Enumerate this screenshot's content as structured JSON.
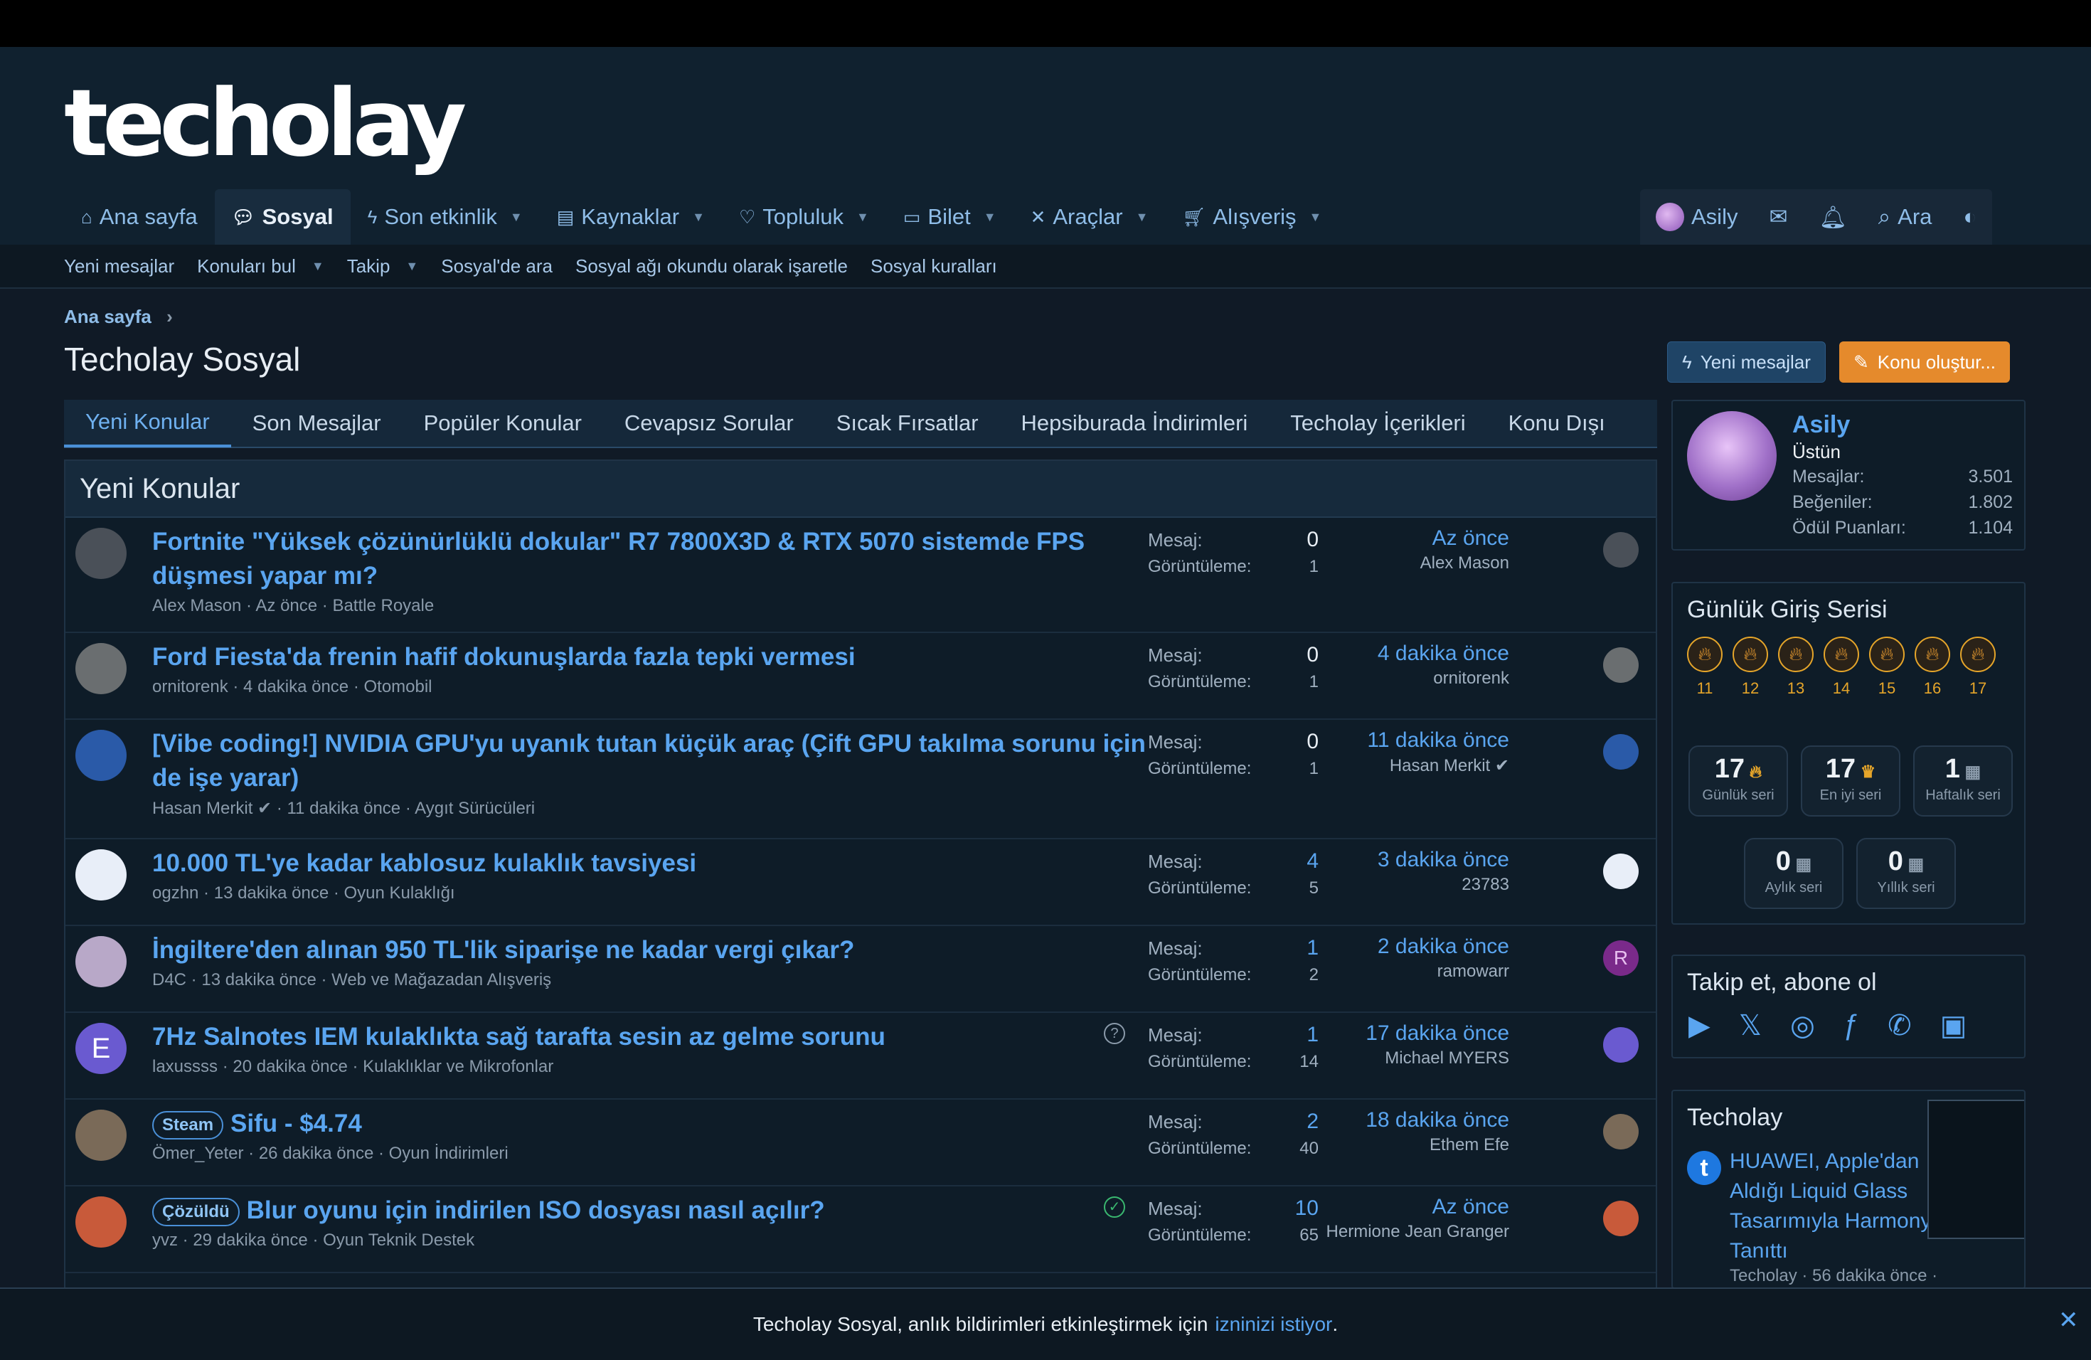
{
  "header": {
    "logo": "techolay"
  },
  "nav": {
    "items": [
      {
        "label": "Ana sayfa",
        "icon": "home-icon",
        "active": false,
        "caret": false
      },
      {
        "label": "Sosyal",
        "icon": "chat-icon",
        "active": true,
        "caret": false
      },
      {
        "label": "Son etkinlik",
        "icon": "bolt-icon",
        "active": false,
        "caret": true
      },
      {
        "label": "Kaynaklar",
        "icon": "archive-icon",
        "active": false,
        "caret": true
      },
      {
        "label": "Topluluk",
        "icon": "heart-icon",
        "active": false,
        "caret": true
      },
      {
        "label": "Bilet",
        "icon": "ticket-icon",
        "active": false,
        "caret": true
      },
      {
        "label": "Araçlar",
        "icon": "tools-icon",
        "active": false,
        "caret": true
      },
      {
        "label": "Alışveriş",
        "icon": "cart-icon",
        "active": false,
        "caret": true
      }
    ],
    "user": "Asily",
    "search": "Ara"
  },
  "subnav": {
    "items": [
      "Yeni mesajlar",
      "Konuları bul",
      "Takip",
      "Sosyal'de ara",
      "Sosyal ağı okundu olarak işaretle",
      "Sosyal kuralları"
    ]
  },
  "breadcrumb": "Ana sayfa",
  "page_title": "Techolay Sosyal",
  "buttons": {
    "new_messages": "Yeni mesajlar",
    "create": "Konu oluştur..."
  },
  "tabs": [
    "Yeni Konular",
    "Son Mesajlar",
    "Popüler Konular",
    "Cevapsız Sorular",
    "Sıcak Fırsatlar",
    "Hepsiburada İndirimleri",
    "Techolay İçerikleri",
    "Konu Dışı"
  ],
  "list": {
    "title": "Yeni Konular",
    "stat_labels": {
      "messages": "Mesaj:",
      "views": "Görüntüleme:"
    },
    "rows": [
      {
        "title": "Fortnite \"Yüksek çözünürlüklü dokular\" R7 7800X3D & RTX 5070 sistemde FPS düşmesi yapar mı?",
        "meta": "Alex Mason · Az önce · Battle Royale",
        "messages": "0",
        "views": "1",
        "last_time": "Az önce",
        "last_user": "Alex Mason",
        "prefix": ""
      },
      {
        "title": "Ford Fiesta'da frenin hafif dokunuşlarda fazla tepki vermesi",
        "meta": "ornitorenk · 4 dakika önce · Otomobil",
        "messages": "0",
        "views": "1",
        "last_time": "4 dakika önce",
        "last_user": "ornitorenk",
        "prefix": ""
      },
      {
        "title": "[Vibe coding!] NVIDIA GPU'yu uyanık tutan küçük araç (Çift GPU takılma sorunu için de işe yarar)",
        "meta": "Hasan Merkit ✔ · 11 dakika önce · Aygıt Sürücüleri",
        "messages": "0",
        "views": "1",
        "last_time": "11 dakika önce",
        "last_user": "Hasan Merkit ✔",
        "prefix": ""
      },
      {
        "title": "10.000 TL'ye kadar kablosuz kulaklık tavsiyesi",
        "meta": "ogzhn · 13 dakika önce · Oyun Kulaklığı",
        "messages": "4",
        "views": "5",
        "last_time": "3 dakika önce",
        "last_user": "23783",
        "prefix": ""
      },
      {
        "title": "İngiltere'den alınan 950 TL'lik siparişe ne kadar vergi çıkar?",
        "meta": "D4C · 13 dakika önce · Web ve Mağazadan Alışveriş",
        "messages": "1",
        "views": "2",
        "last_time": "2 dakika önce",
        "last_user": "ramowarr",
        "prefix": ""
      },
      {
        "title": "7Hz Salnotes IEM kulaklıkta sağ tarafta sesin az gelme sorunu",
        "meta": "laxussss · 20 dakika önce · Kulaklıklar ve Mikrofonlar",
        "messages": "1",
        "views": "14",
        "last_time": "17 dakika önce",
        "last_user": "Michael MYERS",
        "prefix": ""
      },
      {
        "title": "Sifu - $4.74",
        "meta": "Ömer_Yeter · 26 dakika önce · Oyun İndirimleri",
        "messages": "2",
        "views": "40",
        "last_time": "18 dakika önce",
        "last_user": "Ethem Efe",
        "prefix": "Steam"
      },
      {
        "title": "Blur oyunu için indirilen ISO dosyası nasıl açılır?",
        "meta": "yvz · 29 dakika önce · Oyun Teknik Destek",
        "messages": "10",
        "views": "65",
        "last_time": "Az önce",
        "last_user": "Hermione Jean Granger",
        "prefix": "Çözüldü"
      }
    ]
  },
  "profile": {
    "name": "Asily",
    "rank": "Üstün",
    "stats": [
      {
        "label": "Mesajlar:",
        "value": "3.501"
      },
      {
        "label": "Beğeniler:",
        "value": "1.802"
      },
      {
        "label": "Ödül Puanları:",
        "value": "1.104"
      }
    ]
  },
  "streak": {
    "title": "Günlük Giriş Serisi",
    "days": [
      "11",
      "12",
      "13",
      "14",
      "15",
      "16",
      "17"
    ],
    "boxes": [
      {
        "value": "17",
        "label": "Günlük seri"
      },
      {
        "value": "17",
        "label": "En iyi seri"
      },
      {
        "value": "1",
        "label": "Haftalık seri"
      },
      {
        "value": "0",
        "label": "Aylık seri"
      },
      {
        "value": "0",
        "label": "Yıllık seri"
      }
    ]
  },
  "follow": {
    "title": "Takip et, abone ol",
    "icons": [
      "youtube-icon",
      "x-icon",
      "instagram-icon",
      "facebook-icon",
      "whatsapp-icon",
      "linkedin-icon"
    ]
  },
  "techolay_box": {
    "title": "Techolay",
    "headline": "HUAWEI, Apple'dan Aldığı Liquid Glass Tasarımıyla Harmony Tanıttı",
    "meta": "Techolay · 56 dakika önce ·"
  },
  "banner": {
    "text": "Techolay Sosyal, anlık bildirimleri etkinleştirmek için",
    "link": "izninizi istiyor",
    "end": "."
  }
}
